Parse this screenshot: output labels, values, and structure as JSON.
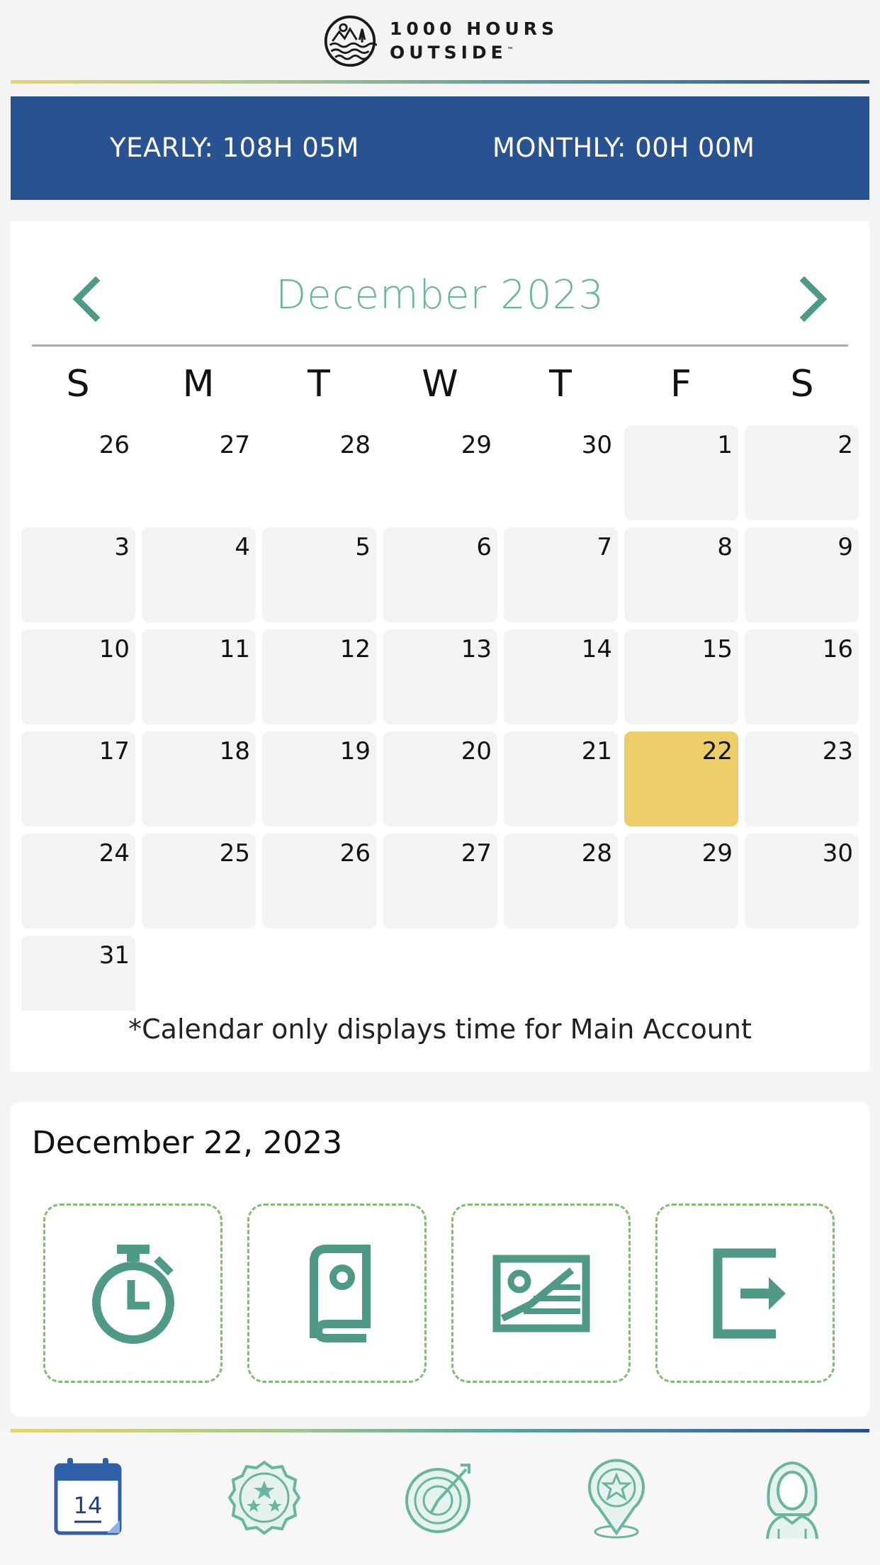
{
  "header": {
    "logo_line1": "1000 HOURS",
    "logo_line2": "OUTSIDE",
    "logo_tm": "™"
  },
  "stats": {
    "yearly": "YEARLY: 108H 05M",
    "monthly": "MONTHLY: 00H 00M"
  },
  "calendar": {
    "month_label": "December 2023",
    "weekdays": [
      "S",
      "M",
      "T",
      "W",
      "T",
      "F",
      "S"
    ],
    "weeks": [
      [
        "26",
        "27",
        "28",
        "29",
        "30",
        "1",
        "2"
      ],
      [
        "3",
        "4",
        "5",
        "6",
        "7",
        "8",
        "9"
      ],
      [
        "10",
        "11",
        "12",
        "13",
        "14",
        "15",
        "16"
      ],
      [
        "17",
        "18",
        "19",
        "20",
        "21",
        "22",
        "23"
      ],
      [
        "24",
        "25",
        "26",
        "27",
        "28",
        "29",
        "30"
      ],
      [
        "31"
      ]
    ],
    "today": "22",
    "note": "*Calendar only displays time for Main Account"
  },
  "selected": {
    "date_label": "December 22, 2023",
    "actions": [
      {
        "icon": "stopwatch-icon"
      },
      {
        "icon": "journal-icon"
      },
      {
        "icon": "photo-icon"
      },
      {
        "icon": "export-icon"
      }
    ]
  },
  "bottom_nav": {
    "items": [
      {
        "icon": "calendar-icon",
        "badge_text": "14",
        "active": true
      },
      {
        "icon": "badges-icon"
      },
      {
        "icon": "timer-icon"
      },
      {
        "icon": "location-star-icon"
      },
      {
        "icon": "profile-icon"
      }
    ]
  },
  "colors": {
    "brand_blue": "#285292",
    "accent_teal": "#4f9a87",
    "month_teal": "#69b6a0",
    "today_yellow": "#ecce68",
    "dashed_green": "#7dbf6d"
  }
}
